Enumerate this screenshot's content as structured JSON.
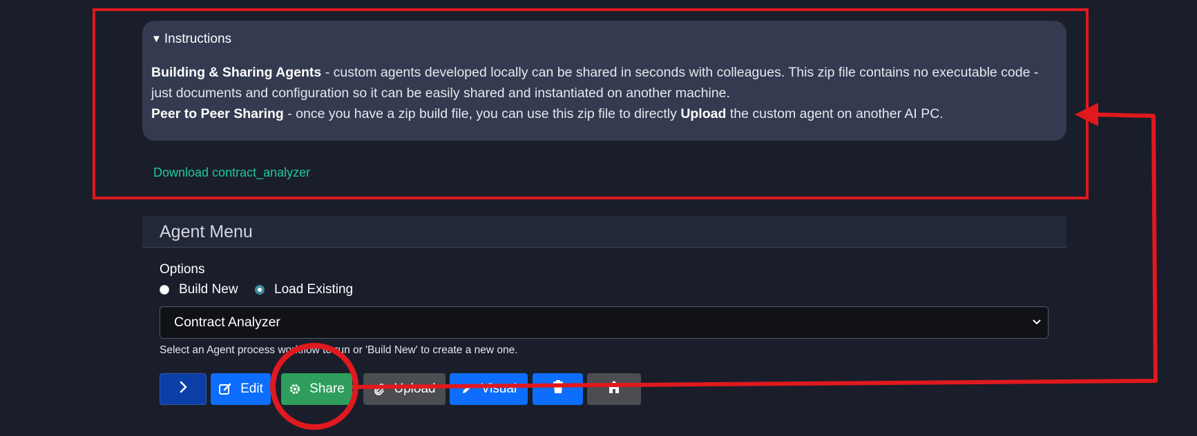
{
  "instructions": {
    "summary": "Instructions",
    "para1_bold": "Building & Sharing Agents",
    "para1_text": " - custom agents developed locally can be shared in seconds with colleagues. This zip file contains no executable code - just documents and configuration so it can be easily shared and instantiated on another machine.",
    "para2_bold": "Peer to Peer Sharing",
    "para2_text_a": " - once you have a zip build file, you can use this zip file to directly ",
    "para2_upload": "Upload",
    "para2_text_b": " the custom agent on another AI PC."
  },
  "download_link": "Download contract_analyzer",
  "agent_menu": {
    "title": "Agent Menu",
    "options_label": "Options",
    "radio_build_new": "Build New",
    "radio_load_existing": "Load Existing",
    "selected_option": "Load Existing",
    "select_value": "Contract Analyzer",
    "help_text": "Select an Agent process workflow to run or 'Build New' to create a new one."
  },
  "buttons": {
    "edit": "Edit",
    "share": "Share",
    "upload": "Upload",
    "visual": "Visual"
  },
  "colors": {
    "background": "#1a1e2b",
    "panel": "#343a50",
    "link": "#20c997",
    "primary": "#0d6efd",
    "success": "#2f9e5c",
    "secondary": "#4b4d51",
    "annotation": "#e0191e"
  },
  "icons": {
    "run": "chevron-right-icon",
    "edit": "pencil-square-icon",
    "share": "gear-icon",
    "upload": "paperclip-icon",
    "visual": "pen-icon",
    "delete": "trash-icon",
    "home": "house-icon"
  }
}
